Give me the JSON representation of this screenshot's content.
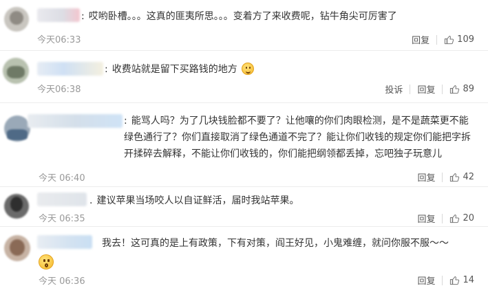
{
  "comments": [
    {
      "text": "哎哟卧槽。。。这真的匪夷所思。。。变着方了来收费呢，钻牛角尖可厉害了",
      "time": "今天06:33",
      "reply": "回复",
      "likes": "109"
    },
    {
      "text": "收费站就是留下买路钱的地方",
      "emoji": "smile-emoji",
      "time": "今天06:38",
      "report": "投诉",
      "reply": "回复",
      "likes": "89"
    },
    {
      "text": "能骂人吗？为了几块钱脸都不要了？让他嚷的你们肉眼检测，是不是蔬菜更不能绿色通行了？你们直接取消了绿色通道不完了？能让你们收钱的规定你们能把字拆开揉碎去解释，不能让你们收钱的，你们能把纲领都丢掉，忘吧独子玩意儿",
      "time": "今天 06:40",
      "reply": "回复",
      "likes": "42"
    },
    {
      "text": "建议苹果当场咬人以自证鲜活，届时我站苹果。",
      "time": "今天 06:35",
      "reply": "回复",
      "likes": "20"
    },
    {
      "text": "我去！这可真的是上有政策，下有对策，阎王好见，小鬼难缠，就问你服不服～～",
      "emoji": "surprised-emoji",
      "time": "今天 06:36",
      "reply": "回复",
      "likes": "14"
    }
  ],
  "colors": {
    "text": "#333333",
    "meta": "#999999",
    "action": "#555555",
    "divider": "#ececec"
  }
}
